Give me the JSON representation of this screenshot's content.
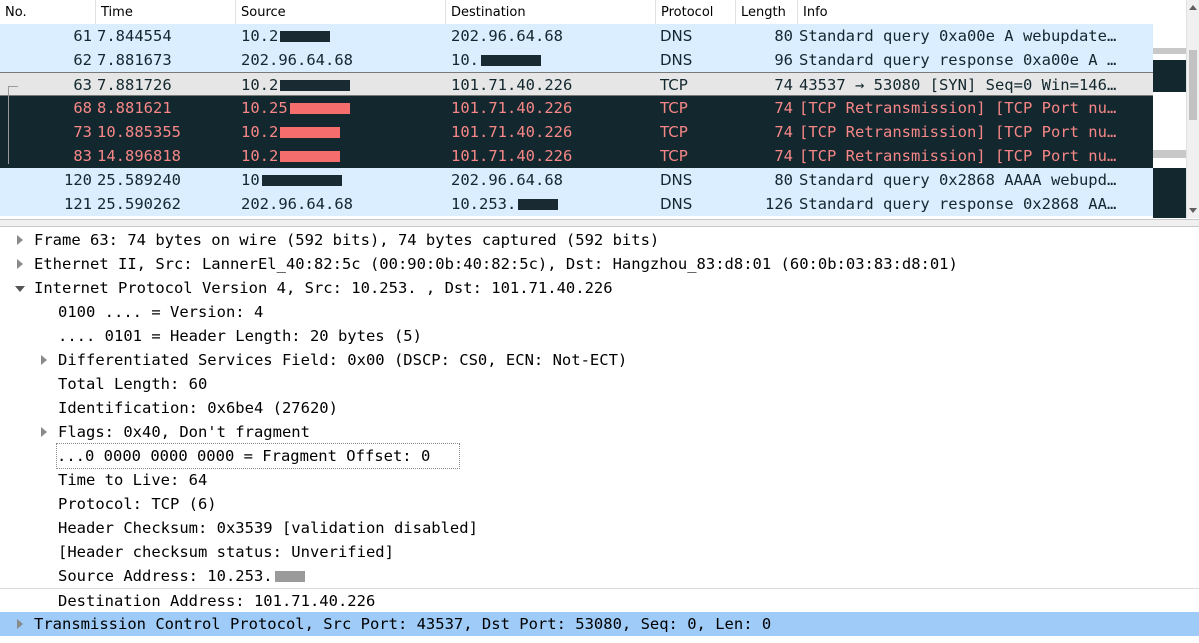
{
  "columns": {
    "no": "No.",
    "time": "Time",
    "source": "Source",
    "destination": "Destination",
    "protocol": "Protocol",
    "length": "Length",
    "info": "Info"
  },
  "packets": [
    {
      "no": "61",
      "time": "7.844554",
      "src": "10.2",
      "dst": "202.96.64.68",
      "proto": "DNS",
      "len": "80",
      "info": "Standard query 0xa00e A webupdate…"
    },
    {
      "no": "62",
      "time": "7.881673",
      "src": "202.96.64.68",
      "dst": "10.",
      "proto": "DNS",
      "len": "96",
      "info": "Standard query response 0xa00e A …"
    },
    {
      "no": "63",
      "time": "7.881726",
      "src": "10.2",
      "dst": "101.71.40.226",
      "proto": "TCP",
      "len": "74",
      "info": "43537 → 53080 [SYN] Seq=0 Win=146…"
    },
    {
      "no": "68",
      "time": "8.881621",
      "src": "10.25",
      "dst": "101.71.40.226",
      "proto": "TCP",
      "len": "74",
      "info": "[TCP Retransmission] [TCP Port nu…"
    },
    {
      "no": "73",
      "time": "10.885355",
      "src": "10.2",
      "dst": "101.71.40.226",
      "proto": "TCP",
      "len": "74",
      "info": "[TCP Retransmission] [TCP Port nu…"
    },
    {
      "no": "83",
      "time": "14.896818",
      "src": "10.2",
      "dst": "101.71.40.226",
      "proto": "TCP",
      "len": "74",
      "info": "[TCP Retransmission] [TCP Port nu…"
    },
    {
      "no": "120",
      "time": "25.589240",
      "src": "10",
      "dst": "202.96.64.68",
      "proto": "DNS",
      "len": "80",
      "info": "Standard query 0x2868 AAAA webupd…"
    },
    {
      "no": "121",
      "time": "25.590262",
      "src": "202.96.64.68",
      "dst": "10.253.",
      "proto": "DNS",
      "len": "126",
      "info": "Standard query response 0x2868 AA…"
    }
  ],
  "details": {
    "frame": "Frame 63: 74 bytes on wire (592 bits), 74 bytes captured (592 bits)",
    "ethernet": "Ethernet II, Src: LannerEl_40:82:5c (00:90:0b:40:82:5c), Dst: Hangzhou_83:d8:01 (60:0b:03:83:d8:01)",
    "ip": "Internet Protocol Version 4, Src: 10.253.   , Dst: 101.71.40.226",
    "version": "0100 .... = Version: 4",
    "header_length": ".... 0101 = Header Length: 20 bytes (5)",
    "dsfield": "Differentiated Services Field: 0x00 (DSCP: CS0, ECN: Not-ECT)",
    "total_length": "Total Length: 60",
    "identification": "Identification: 0x6be4 (27620)",
    "flags": "Flags: 0x40, Don't fragment",
    "frag_offset": "...0 0000 0000 0000 = Fragment Offset: 0",
    "ttl": "Time to Live: 64",
    "protocol": "Protocol: TCP (6)",
    "checksum": "Header Checksum: 0x3539 [validation disabled]",
    "checksum_status": "[Header checksum status: Unverified]",
    "src_addr": "Source Address: 10.253.",
    "dst_addr": "Destination Address: 101.71.40.226",
    "tcp": "Transmission Control Protocol, Src Port: 43537, Dst Port: 53080, Seq: 0, Len: 0"
  },
  "colors": {
    "dns_row": "#daeeff",
    "retransmission_bg": "#12272e",
    "retransmission_fg": "#f78787",
    "selected_detail": "#9ecbf7"
  }
}
